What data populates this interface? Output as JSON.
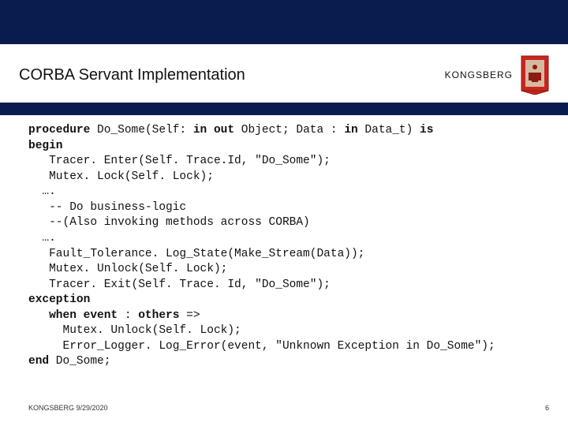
{
  "header": {
    "title": "CORBA Servant Implementation",
    "brand": "KONGSBERG"
  },
  "code": {
    "l1a": "procedure",
    "l1b": " Do_Some(Self: ",
    "l1c": "in out",
    "l1d": " Object; Data : ",
    "l1e": "in",
    "l1f": " Data_t) ",
    "l1g": "is",
    "l2": "begin",
    "l3": "   Tracer. Enter(Self. Trace.Id, \"Do_Some\");",
    "l4": "   Mutex. Lock(Self. Lock);",
    "l5": "  ….",
    "l6": "   -- Do business-logic",
    "l7": "   --(Also invoking methods across CORBA)",
    "l8": "  ….",
    "l9": "   Fault_Tolerance. Log_State(Make_Stream(Data));",
    "l10": "   Mutex. Unlock(Self. Lock);",
    "l11": "   Tracer. Exit(Self. Trace. Id, \"Do_Some\");",
    "l12": "exception",
    "l13a": "   ",
    "l13b": "when event",
    "l13c": " : ",
    "l13d": "others",
    "l13e": " =>",
    "l14": "     Mutex. Unlock(Self. Lock);",
    "l15": "     Error_Logger. Log_Error(event, \"Unknown Exception in Do_Some\");",
    "l16a": "end",
    "l16b": " Do_Some;"
  },
  "footer": {
    "left": "KONGSBERG 9/29/2020",
    "right": "6"
  }
}
